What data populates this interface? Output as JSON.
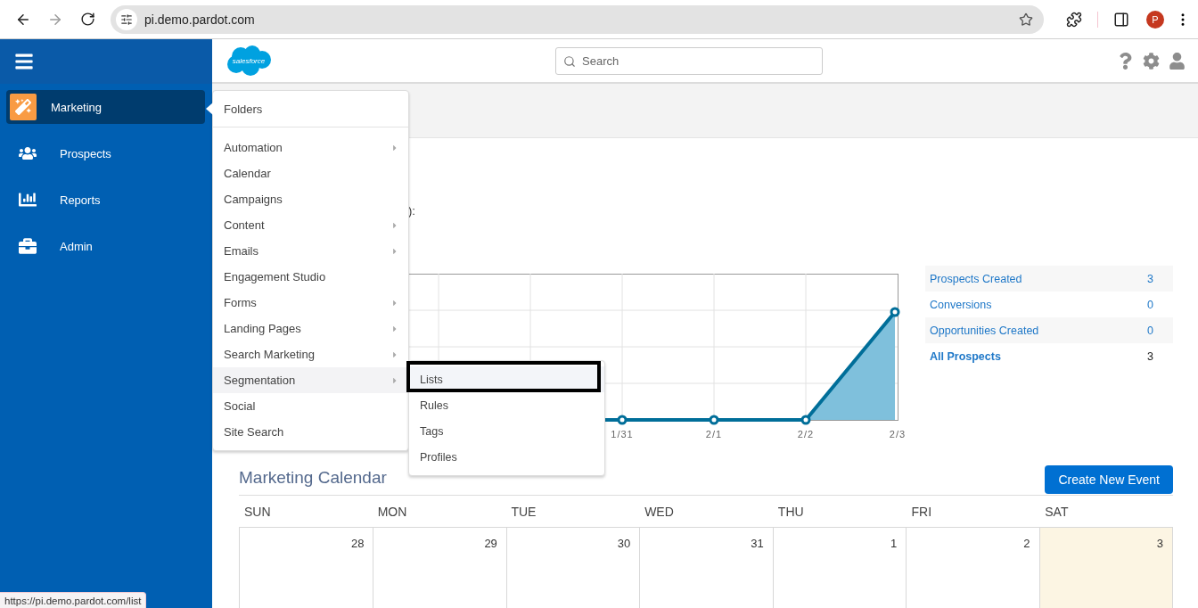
{
  "browser": {
    "url": "pi.demo.pardot.com",
    "profile_initial": "P",
    "status_url": "https://pi.demo.pardot.com/list"
  },
  "sidebar": {
    "items": [
      {
        "label": "Marketing",
        "selected": true
      },
      {
        "label": "Prospects",
        "selected": false
      },
      {
        "label": "Reports",
        "selected": false
      },
      {
        "label": "Admin",
        "selected": false
      }
    ]
  },
  "header": {
    "logo": "salesforce",
    "search_placeholder": "Search"
  },
  "dashboard": {
    "note": "):",
    "chart": {
      "x_labels": [
        "1/31",
        "2/1",
        "2/2",
        "2/3"
      ]
    },
    "stats": [
      {
        "label": "Prospects Created",
        "value": "3",
        "kind": "metric"
      },
      {
        "label": "Conversions",
        "value": "0",
        "kind": "metric"
      },
      {
        "label": "Opportunities Created",
        "value": "0",
        "kind": "metric"
      },
      {
        "label": "All Prospects",
        "value": "3",
        "kind": "total"
      }
    ]
  },
  "calendar": {
    "title": "Marketing Calendar",
    "create_button": "Create New Event",
    "weekdays": [
      "SUN",
      "MON",
      "TUE",
      "WED",
      "THU",
      "FRI",
      "SAT"
    ],
    "days": [
      {
        "label": "28",
        "today": false
      },
      {
        "label": "29",
        "today": false
      },
      {
        "label": "30",
        "today": false
      },
      {
        "label": "31",
        "today": false
      },
      {
        "label": "1",
        "today": false
      },
      {
        "label": "2",
        "today": false
      },
      {
        "label": "3",
        "today": true
      }
    ]
  },
  "menu": {
    "top_item": "Folders",
    "items": [
      {
        "label": "Automation",
        "has_submenu": true,
        "selected": false
      },
      {
        "label": "Calendar",
        "has_submenu": false,
        "selected": false
      },
      {
        "label": "Campaigns",
        "has_submenu": false,
        "selected": false
      },
      {
        "label": "Content",
        "has_submenu": true,
        "selected": false
      },
      {
        "label": "Emails",
        "has_submenu": true,
        "selected": false
      },
      {
        "label": "Engagement Studio",
        "has_submenu": false,
        "selected": false
      },
      {
        "label": "Forms",
        "has_submenu": true,
        "selected": false
      },
      {
        "label": "Landing Pages",
        "has_submenu": true,
        "selected": false
      },
      {
        "label": "Search Marketing",
        "has_submenu": true,
        "selected": false
      },
      {
        "label": "Segmentation",
        "has_submenu": true,
        "selected": true
      },
      {
        "label": "Social",
        "has_submenu": false,
        "selected": false
      },
      {
        "label": "Site Search",
        "has_submenu": false,
        "selected": false
      }
    ]
  },
  "submenu": {
    "items": [
      {
        "label": "Lists",
        "selected": true,
        "outlined": true
      },
      {
        "label": "Rules",
        "selected": false,
        "outlined": false
      },
      {
        "label": "Tags",
        "selected": false,
        "outlined": false
      },
      {
        "label": "Profiles",
        "selected": false,
        "outlined": false
      }
    ]
  }
}
